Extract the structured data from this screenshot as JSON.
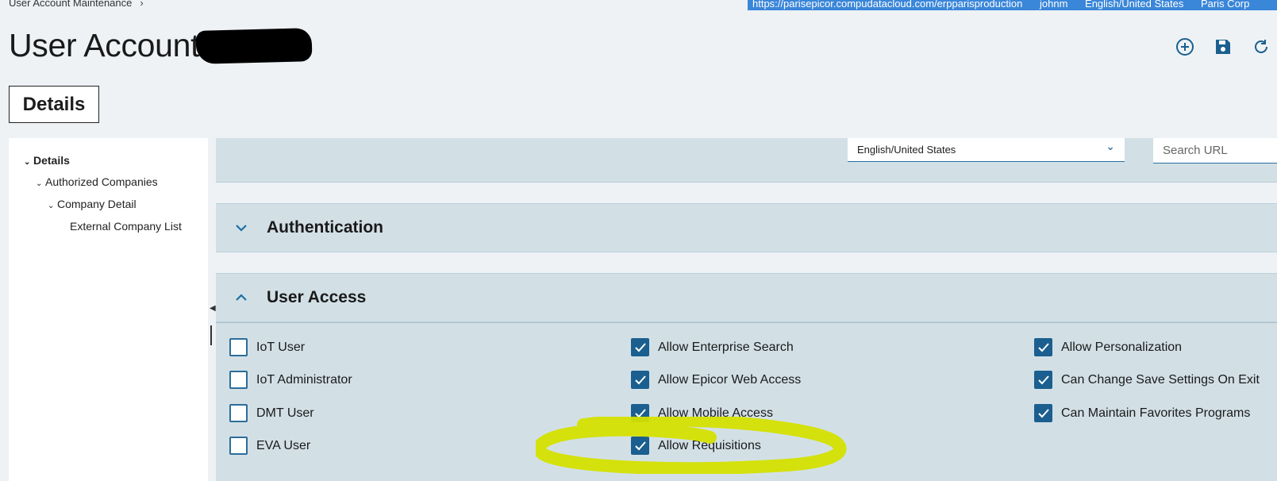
{
  "breadcrumb": {
    "label": "User Account Maintenance",
    "chevron": "›"
  },
  "infobar": {
    "url": "https://parisepicor.compudatacloud.com/erpparisproduction",
    "user": "johnm",
    "language": "English/United States",
    "company": "Paris Corp"
  },
  "page": {
    "title": "User Account"
  },
  "toolbar": {
    "icons": [
      "add-new-icon",
      "save-icon",
      "refresh-icon"
    ]
  },
  "tabs": {
    "details": "Details"
  },
  "tree": {
    "items": [
      {
        "label": "Details",
        "level": 0
      },
      {
        "label": "Authorized Companies",
        "level": 1
      },
      {
        "label": "Company Detail",
        "level": 2
      },
      {
        "label": "External Company List",
        "level": 3
      }
    ]
  },
  "language_field": {
    "value": "English/United States"
  },
  "search_url": {
    "placeholder": "Search URL"
  },
  "sections": {
    "authentication": "Authentication",
    "user_access": "User Access"
  },
  "checkboxes": {
    "col1": [
      {
        "label": "IoT User",
        "checked": false
      },
      {
        "label": "IoT Administrator",
        "checked": false
      },
      {
        "label": "DMT User",
        "checked": false
      },
      {
        "label": "EVA User",
        "checked": false
      }
    ],
    "col2": [
      {
        "label": "Allow Enterprise Search",
        "checked": true
      },
      {
        "label": "Allow Epicor Web Access",
        "checked": true
      },
      {
        "label": "Allow Mobile Access",
        "checked": true
      },
      {
        "label": "Allow Requisitions",
        "checked": true
      }
    ],
    "col3": [
      {
        "label": "Allow Personalization",
        "checked": true
      },
      {
        "label": "Can Change Save Settings On Exit",
        "checked": true
      },
      {
        "label": "Can Maintain Favorites Programs",
        "checked": true
      }
    ]
  },
  "colors": {
    "accent": "#1a5f8f",
    "panel": "#d2e0e6",
    "infobar": "#3a86d9",
    "highlight": "#d4e000"
  }
}
